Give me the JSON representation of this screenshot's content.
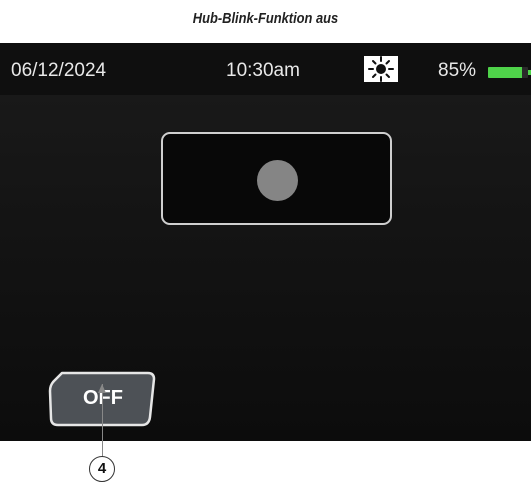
{
  "caption": "Hub-Blink-Funktion aus",
  "status_bar": {
    "date": "06/12/2024",
    "time": "10:30am",
    "brightness_icon": "sun-icon",
    "battery_percent": "85%",
    "battery_level": 0.85,
    "battery_color": "#4fd34a"
  },
  "indicator": {
    "state": "off",
    "dot_color": "#858585"
  },
  "softkey": {
    "label": "OFF"
  },
  "callout": {
    "number": "4"
  }
}
